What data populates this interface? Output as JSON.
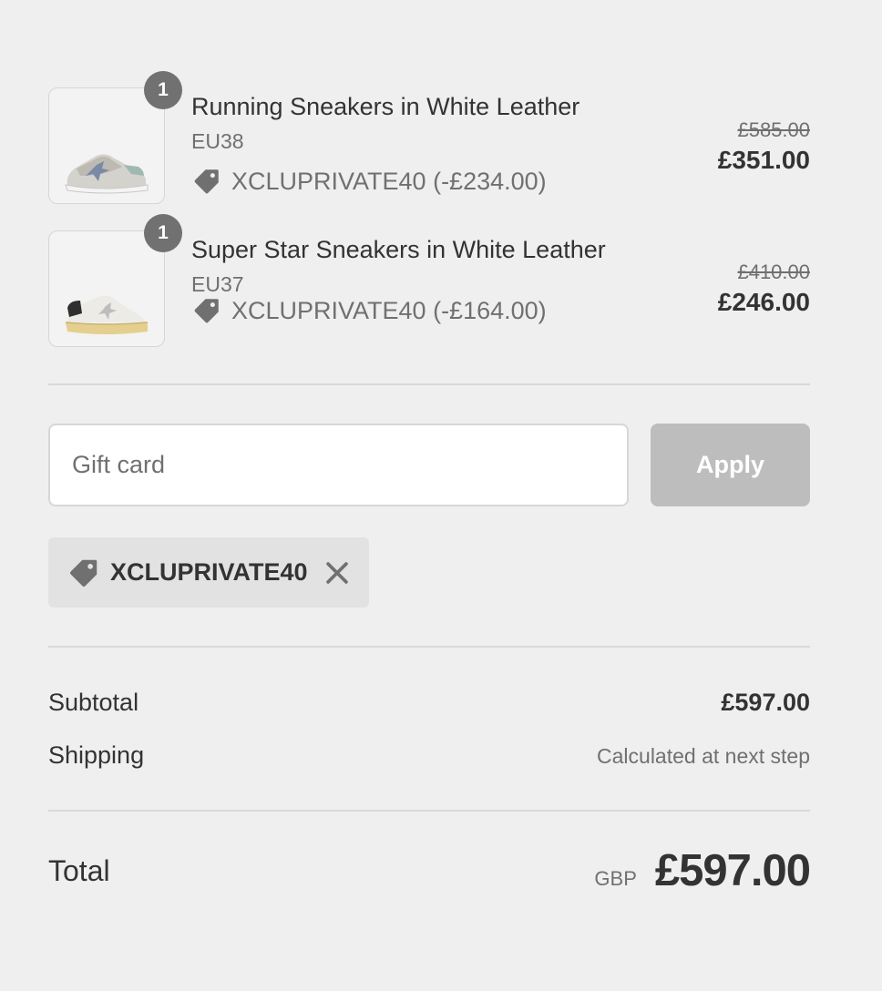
{
  "items": [
    {
      "quantity": "1",
      "title": "Running Sneakers in White Leather",
      "variant": "EU38",
      "discount": "XCLUPRIVATE40 (-£234.00)",
      "original_price": "£585.00",
      "final_price": "£351.00",
      "image": "running-sneaker-thumbnail"
    },
    {
      "quantity": "1",
      "title": "Super Star Sneakers in White Leather",
      "variant": "EU37",
      "discount": "XCLUPRIVATE40 (-£164.00)",
      "original_price": "£410.00",
      "final_price": "£246.00",
      "image": "superstar-sneaker-thumbnail"
    }
  ],
  "gift_card": {
    "placeholder": "Gift card",
    "value": "",
    "apply_label": "Apply"
  },
  "applied_code": {
    "code": "XCLUPRIVATE40",
    "icon": "tag-icon",
    "remove_icon": "close-icon"
  },
  "totals": {
    "subtotal_label": "Subtotal",
    "subtotal_value": "£597.00",
    "shipping_label": "Shipping",
    "shipping_value": "Calculated at next step",
    "total_label": "Total",
    "currency": "GBP",
    "total_value": "£597.00"
  },
  "colors": {
    "background": "#efefef",
    "text": "#333333",
    "muted": "#707070",
    "badge": "#717171",
    "apply_disabled": "#bdbdbd",
    "chip": "#e2e2e2"
  }
}
